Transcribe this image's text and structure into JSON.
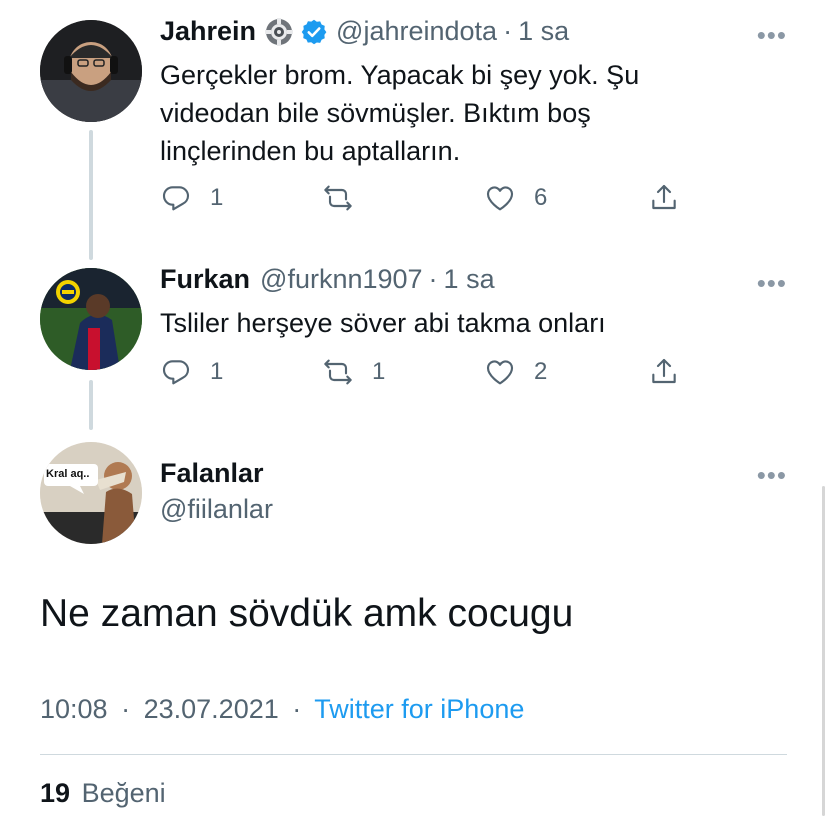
{
  "tweets": [
    {
      "name": "Jahrein",
      "handle": "@jahreindota",
      "sep": "·",
      "time": "1 sa",
      "text": "Gerçekler brom. Yapacak bi şey yok. Şu videodan bile sövmüşler. Bıktım boş linçlerinden bu aptalların.",
      "replies": "1",
      "retweets": "",
      "likes": "6"
    },
    {
      "name": "Furkan",
      "handle": "@furknn1907",
      "sep": "·",
      "time": "1 sa",
      "text": "Tsliler herşeye söver abi takma onları",
      "replies": "1",
      "retweets": "1",
      "likes": "2"
    }
  ],
  "main_tweet": {
    "name": "Falanlar",
    "handle": "@fiilanlar",
    "avatar_caption": "Kral aq..",
    "text": "Ne zaman sövdük amk cocugu",
    "time": "10:08",
    "date": "23.07.2021",
    "sep": "·",
    "source": "Twitter for iPhone",
    "like_count": "19",
    "like_label": "Beğeni"
  },
  "more_label": "•••",
  "colors": {
    "link": "#1d9bf0",
    "secondary": "#536471",
    "verified": "#1d9bf0"
  },
  "icons": [
    "reply-icon",
    "retweet-icon",
    "like-icon",
    "share-icon",
    "verified-icon",
    "gear-badge-icon",
    "more-icon"
  ]
}
